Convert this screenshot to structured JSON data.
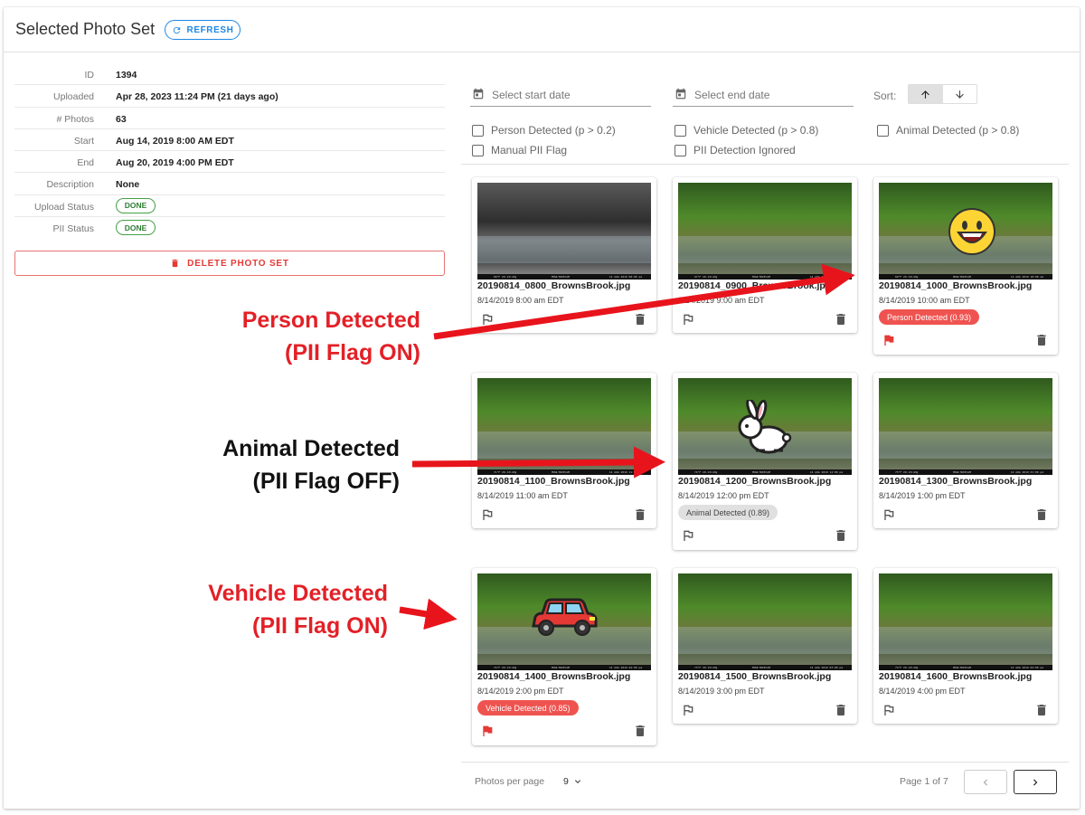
{
  "header": {
    "title": "Selected Photo Set",
    "refresh_label": "REFRESH"
  },
  "details": {
    "rows": [
      {
        "label": "ID",
        "value": "1394"
      },
      {
        "label": "Uploaded",
        "value": "Apr 28, 2023 11:24 PM (21 days ago)"
      },
      {
        "label": "# Photos",
        "value": "63"
      },
      {
        "label": "Start",
        "value": "Aug 14, 2019 8:00 AM EDT"
      },
      {
        "label": "End",
        "value": "Aug 20, 2019 4:00 PM EDT"
      },
      {
        "label": "Description",
        "value": "None"
      },
      {
        "label": "Upload Status",
        "value": "DONE"
      },
      {
        "label": "PII Status",
        "value": "DONE"
      }
    ],
    "delete_label": "DELETE PHOTO SET"
  },
  "filters": {
    "start_date_placeholder": "Select start date",
    "end_date_placeholder": "Select end date",
    "sort_label": "Sort:",
    "checkboxes": [
      {
        "label": "Person Detected (p > 0.2)",
        "checked": false
      },
      {
        "label": "Vehicle Detected (p > 0.8)",
        "checked": false
      },
      {
        "label": "Animal Detected (p > 0.8)",
        "checked": false
      },
      {
        "label": "Manual PII Flag",
        "checked": false
      },
      {
        "label": "PII Detection Ignored",
        "checked": false
      }
    ]
  },
  "photos": [
    {
      "filename": "20190814_0800_BrownsBrook.jpg",
      "datetime": "8/14/2019 8:00 am EDT",
      "badge": "",
      "flagged": false,
      "overlay": "",
      "bar_left": "60°F 29.13inHg",
      "bar_right": "14 AUG 2019 08:00 am"
    },
    {
      "filename": "20190814_0900_BrownsBrook.jpg",
      "datetime": "8/14/2019 9:00 am EDT",
      "badge": "",
      "flagged": false,
      "overlay": "",
      "bar_left": "67°F 29.13inHg",
      "bar_right": "14 AUG 2019 09:00 am"
    },
    {
      "filename": "20190814_1000_BrownsBrook.jpg",
      "datetime": "8/14/2019 10:00 am EDT",
      "badge": "Person Detected (0.93)",
      "badge_color": "#ef5350",
      "flagged": true,
      "overlay": "person",
      "bar_left": "69°F 29.13inHg",
      "bar_right": "14 AUG 2019 10:00 am"
    },
    {
      "filename": "20190814_1100_BrownsBrook.jpg",
      "datetime": "8/14/2019 11:00 am EDT",
      "badge": "",
      "flagged": false,
      "overlay": "",
      "bar_left": "71°F 29.13inHg",
      "bar_right": "14 AUG 2019 11:00 am"
    },
    {
      "filename": "20190814_1200_BrownsBrook.jpg",
      "datetime": "8/14/2019 12:00 pm EDT",
      "badge": "Animal Detected (0.89)",
      "badge_color": "#e0e0e0",
      "flagged": false,
      "overlay": "animal",
      "bar_left": "74°F 29.13inHg",
      "bar_right": "14 AUG 2019 12:00 pm"
    },
    {
      "filename": "20190814_1300_BrownsBrook.jpg",
      "datetime": "8/14/2019 1:00 pm EDT",
      "badge": "",
      "flagged": false,
      "overlay": "",
      "bar_left": "75°F 29.13inHg",
      "bar_right": "14 AUG 2019 01:00 pm"
    },
    {
      "filename": "20190814_1400_BrownsBrook.jpg",
      "datetime": "8/14/2019 2:00 pm EDT",
      "badge": "Vehicle Detected (0.85)",
      "badge_color": "#ef5350",
      "flagged": true,
      "overlay": "vehicle",
      "bar_left": "74°F 29.13inHg",
      "bar_right": "14 AUG 2019 02:00 pm"
    },
    {
      "filename": "20190814_1500_BrownsBrook.jpg",
      "datetime": "8/14/2019 3:00 pm EDT",
      "badge": "",
      "flagged": false,
      "overlay": "",
      "bar_left": "73°F 29.13inHg",
      "bar_right": "14 AUG 2019 03:00 pm"
    },
    {
      "filename": "20190814_1600_BrownsBrook.jpg",
      "datetime": "8/14/2019 4:00 pm EDT",
      "badge": "",
      "flagged": false,
      "overlay": "",
      "bar_left": "73°F 29.13inHg",
      "bar_right": "14 AUG 2019 04:00 pm"
    }
  ],
  "camera_label": "MOULTRIECAM",
  "pagination": {
    "per_page_label": "Photos per page",
    "per_page_value": "9",
    "page_label": "Page 1 of 7"
  },
  "annotations": {
    "person": {
      "line1": "Person Detected",
      "line2": "(PII Flag ON)"
    },
    "animal": {
      "line1": "Animal Detected",
      "line2": "(PII Flag OFF)"
    },
    "vehicle": {
      "line1": "Vehicle Detected",
      "line2": "(PII Flag ON)"
    }
  },
  "colors": {
    "accent": "#1e88e5",
    "danger": "#e53935",
    "success": "#43a047",
    "annotation_red": "#e32027"
  },
  "icons": {
    "refresh": "refresh-icon",
    "delete": "trash-icon",
    "calendar": "calendar-icon",
    "sort_asc": "arrow-up-icon",
    "sort_desc": "arrow-down-icon",
    "flag": "flag-icon",
    "trash": "trash-icon",
    "prev": "chevron-left-icon",
    "next": "chevron-right-icon"
  }
}
